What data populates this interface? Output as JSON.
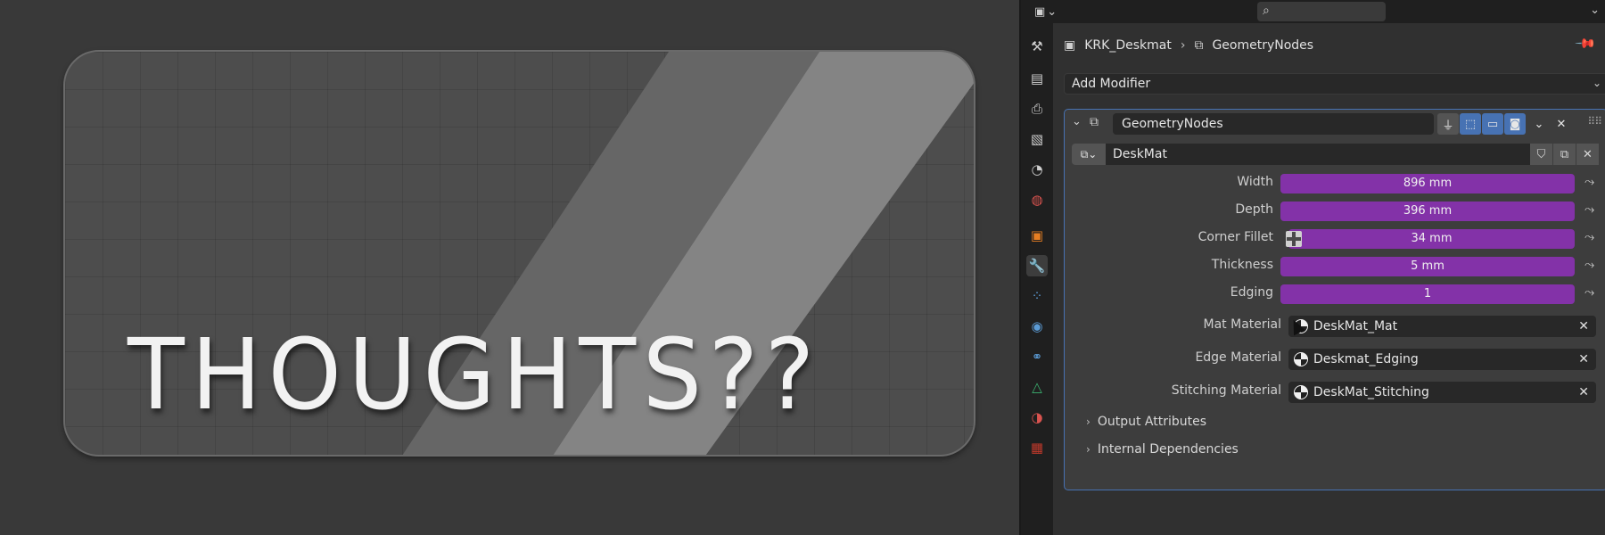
{
  "viewport": {
    "mat_text": "THOUGHTS??"
  },
  "topbar": {
    "editor_type_icon": "properties-editor-icon",
    "search_placeholder": ""
  },
  "tabs": [
    {
      "icon": "tool-icon"
    },
    {
      "icon": "render-icon"
    },
    {
      "icon": "output-icon"
    },
    {
      "icon": "view-layer-icon"
    },
    {
      "icon": "scene-icon"
    },
    {
      "icon": "world-icon"
    },
    {
      "icon": "object-icon"
    },
    {
      "icon": "modifier-wrench-icon",
      "active": true
    },
    {
      "icon": "particles-icon"
    },
    {
      "icon": "physics-icon"
    },
    {
      "icon": "constraints-icon"
    },
    {
      "icon": "object-data-icon"
    },
    {
      "icon": "material-icon"
    },
    {
      "icon": "texture-icon"
    }
  ],
  "breadcrumb": {
    "object": "KRK_Deskmat",
    "modifier": "GeometryNodes"
  },
  "add_modifier_label": "Add Modifier",
  "modifier": {
    "name": "GeometryNodes",
    "node_group": "DeskMat",
    "properties": [
      {
        "label": "Width",
        "value": "896 mm"
      },
      {
        "label": "Depth",
        "value": "396 mm"
      },
      {
        "label": "Corner Fillet",
        "value": "34 mm"
      },
      {
        "label": "Thickness",
        "value": "5 mm"
      },
      {
        "label": "Edging",
        "value": "1"
      }
    ],
    "materials": [
      {
        "label": "Mat Material",
        "value": "DeskMat_Mat"
      },
      {
        "label": "Edge Material",
        "value": "Deskmat_Edging"
      },
      {
        "label": "Stitching Material",
        "value": "DeskMat_Stitching"
      }
    ],
    "subpanels": [
      "Output Attributes",
      "Internal Dependencies"
    ]
  },
  "colors": {
    "accent": "#4772b3",
    "field_purple": "#8332a8"
  }
}
